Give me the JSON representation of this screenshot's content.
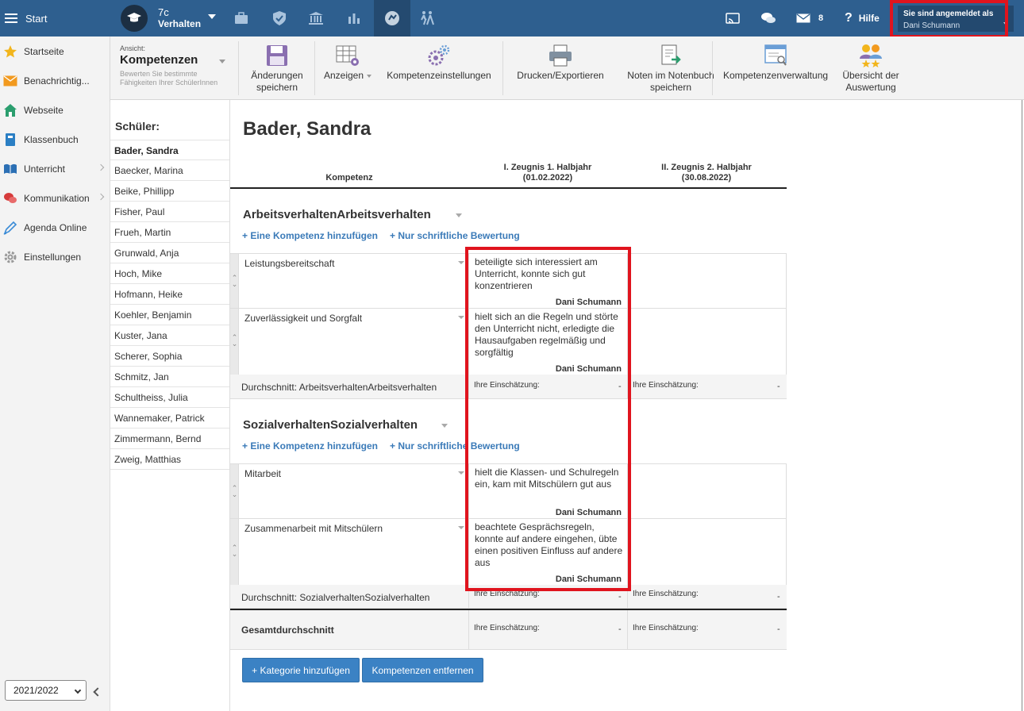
{
  "topbar": {
    "start_label": "Start",
    "class_number": "7c",
    "class_view": "Verhalten",
    "message_count": "8",
    "help_label": "Hilfe",
    "login_line1": "Sie sind angemeldet als",
    "login_user": "Dani Schumann",
    "nav_icons": [
      "briefcase-icon",
      "shield-icon",
      "bank-icon",
      "chart-icon",
      "behavior-icon",
      "students-walking-icon"
    ]
  },
  "sidebar": {
    "items": [
      {
        "label": "Startseite",
        "icon": "star-icon"
      },
      {
        "label": "Benachrichtig...",
        "icon": "envelope-icon"
      },
      {
        "label": "Webseite",
        "icon": "home-icon"
      },
      {
        "label": "Klassenbuch",
        "icon": "book-icon"
      },
      {
        "label": "Unterricht",
        "icon": "open-book-icon"
      },
      {
        "label": "Kommunikation",
        "icon": "chat-icon"
      },
      {
        "label": "Agenda Online",
        "icon": "pen-icon"
      },
      {
        "label": "Einstellungen",
        "icon": "gear-icon"
      }
    ],
    "school_year": "2021/2022"
  },
  "toolbar": {
    "view_label": "Ansicht:",
    "view_value": "Kompetenzen",
    "view_desc_line1": "Bewerten Sie bestimmte",
    "view_desc_line2": "Fähigkeiten Ihrer SchülerInnen",
    "save_line1": "Änderungen",
    "save_line2": "speichern",
    "show": "Anzeigen",
    "competence_settings": "Kompetenzeinstellungen",
    "print": "Drucken/Exportieren",
    "grades_line1": "Noten im Notenbuch",
    "grades_line2": "speichern",
    "competence_admin": "Kompetenzenverwaltung",
    "overview_line1": "Übersicht der",
    "overview_line2": "Auswertung"
  },
  "students": {
    "header": "Schüler:",
    "list": [
      "Bader, Sandra",
      "Baecker, Marina",
      "Beike, Phillipp",
      "Fisher, Paul",
      "Frueh, Martin",
      "Grunwald, Anja",
      "Hoch, Mike",
      "Hofmann, Heike",
      "Koehler, Benjamin",
      "Kuster, Jana",
      "Scherer, Sophia",
      "Schmitz, Jan",
      "Schultheiss, Julia",
      "Wannemaker, Patrick",
      "Zimmermann, Bernd",
      "Zweig, Matthias"
    ]
  },
  "main": {
    "student_name": "Bader, Sandra",
    "col_competence": "Kompetenz",
    "col1_line1": "I. Zeugnis 1. Halbjahr",
    "col1_line2": "(01.02.2022)",
    "col2_line1": "II. Zeugnis 2. Halbjahr",
    "col2_line2": "(30.08.2022)",
    "add_competence": "+ Eine Kompetenz hinzufügen",
    "written_only": "+ Nur schriftliche Bewertung",
    "estimate_label": "Ihre Einschätzung:",
    "dash": "-",
    "categories": [
      {
        "title": "ArbeitsverhaltenArbeitsverhalten",
        "rows": [
          {
            "name": "Leistungsbereitschaft",
            "text": "beteiligte sich interessiert am Unterricht, konnte sich gut konzentrieren",
            "author": "Dani Schumann"
          },
          {
            "name": "Zuverlässigkeit und Sorgfalt",
            "text": "hielt sich an die Regeln und störte den Unterricht nicht, erledigte die Hausaufgaben regelmäßig und sorgfältig",
            "author": "Dani Schumann"
          }
        ],
        "average": "Durchschnitt: ArbeitsverhaltenArbeitsverhalten"
      },
      {
        "title": "SozialverhaltenSozialverhalten",
        "rows": [
          {
            "name": "Mitarbeit",
            "text": "hielt die Klassen- und Schulregeln ein, kam mit Mitschülern gut aus",
            "author": "Dani Schumann"
          },
          {
            "name": "Zusammenarbeit mit Mitschülern",
            "text": "beachtete Gesprächsregeln, konnte auf andere eingehen, übte einen positiven Einfluss auf andere aus",
            "author": "Dani Schumann"
          }
        ],
        "average": "Durchschnitt: SozialverhaltenSozialverhalten"
      }
    ],
    "total_average": "Gesamtdurchschnitt",
    "add_category": "+ Kategorie hinzufügen",
    "remove_competences": "Kompetenzen entfernen"
  },
  "colors": {
    "topbar": "#2e5f8f",
    "accent_link": "#3a7ab8",
    "button": "#3b82c4",
    "highlight_red": "#e0141e"
  }
}
